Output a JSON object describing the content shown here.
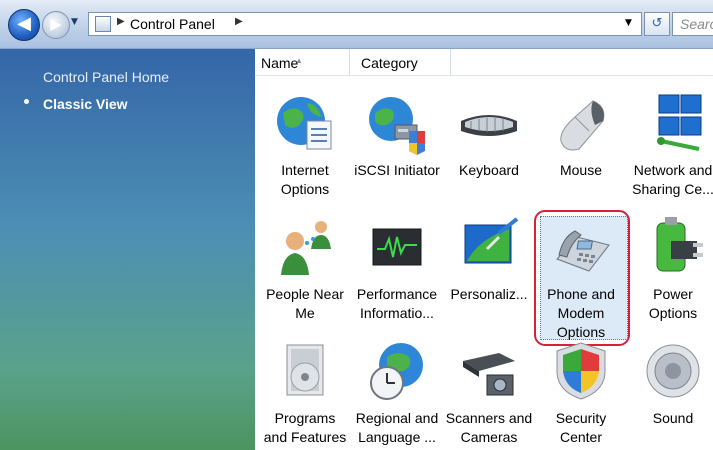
{
  "address": {
    "location": "Control Panel",
    "search_placeholder": "Search"
  },
  "left_pane": {
    "home_link": "Control Panel Home",
    "classic_view": "Classic View"
  },
  "columns": [
    "Name",
    "Category"
  ],
  "items": [
    {
      "line1": "Internet",
      "line2": "Options",
      "icon": "internet-options-icon"
    },
    {
      "line1": "iSCSI Initiator",
      "line2": "",
      "icon": "iscsi-initiator-icon"
    },
    {
      "line1": "Keyboard",
      "line2": "",
      "icon": "keyboard-icon"
    },
    {
      "line1": "Mouse",
      "line2": "",
      "icon": "mouse-icon"
    },
    {
      "line1": "Network and",
      "line2": "Sharing Ce...",
      "icon": "network-sharing-icon"
    },
    {
      "line1": "People Near",
      "line2": "Me",
      "icon": "people-near-me-icon"
    },
    {
      "line1": "Performance",
      "line2": "Informatio...",
      "icon": "performance-icon"
    },
    {
      "line1": "Personaliz...",
      "line2": "",
      "icon": "personalization-icon"
    },
    {
      "line1": "Phone and",
      "line2": "Modem",
      "line3": "Options",
      "icon": "phone-modem-icon",
      "selected": true
    },
    {
      "line1": "Power",
      "line2": "Options",
      "icon": "power-options-icon"
    },
    {
      "line1": "Programs",
      "line2": "and Features",
      "icon": "programs-features-icon"
    },
    {
      "line1": "Regional and",
      "line2": "Language ...",
      "icon": "regional-language-icon"
    },
    {
      "line1": "Scanners and",
      "line2": "Cameras",
      "icon": "scanners-cameras-icon"
    },
    {
      "line1": "Security",
      "line2": "Center",
      "icon": "security-center-icon"
    },
    {
      "line1": "Sound",
      "line2": "",
      "icon": "sound-icon"
    }
  ]
}
